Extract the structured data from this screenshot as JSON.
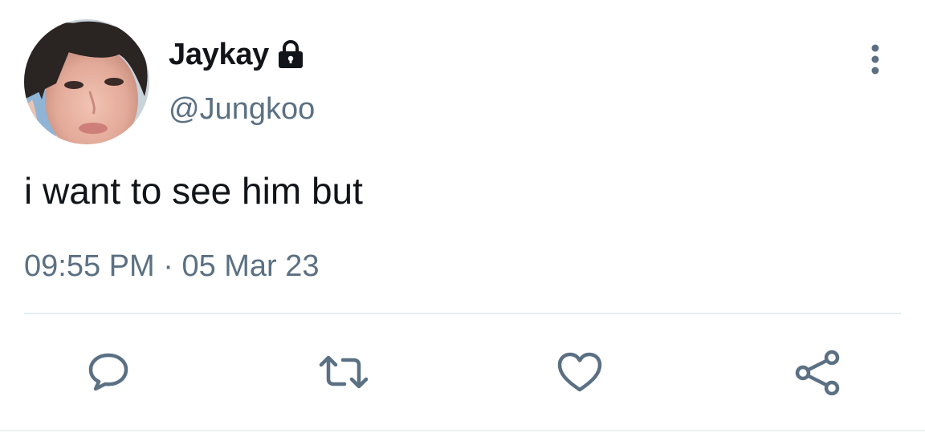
{
  "user": {
    "display_name": "Jaykay",
    "handle": "@Jungkoo",
    "protected_icon": "lock-icon",
    "avatar": "profile-photo"
  },
  "tweet": {
    "text": "i want to see him but",
    "time": "09:55 PM",
    "separator": "·",
    "date": "05 Mar 23"
  },
  "actions": [
    {
      "icon": "reply-icon"
    },
    {
      "icon": "retweet-icon"
    },
    {
      "icon": "like-icon"
    },
    {
      "icon": "share-icon"
    }
  ],
  "menu": {
    "icon": "more-vertical-icon"
  },
  "colors": {
    "text_primary": "#111418",
    "text_secondary": "#5b7083",
    "icon": "#5b7083",
    "divider": "#e6ecf0"
  }
}
